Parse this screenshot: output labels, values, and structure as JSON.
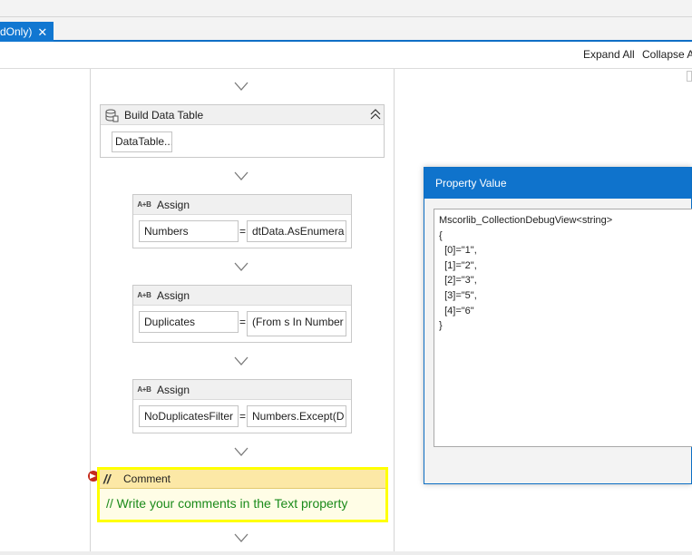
{
  "tab": {
    "label": "dOnly)",
    "close_glyph": "✕"
  },
  "toolbar": {
    "expand_all": "Expand All",
    "collapse_all": "Collapse A"
  },
  "activities": {
    "build_table": {
      "title": "Build Data Table",
      "button": "DataTable..."
    },
    "assign1": {
      "icon_text": "A+B",
      "title": "Assign",
      "to": "Numbers",
      "eq": "=",
      "value": "dtData.AsEnumera"
    },
    "assign2": {
      "icon_text": "A+B",
      "title": "Assign",
      "to": "Duplicates",
      "eq": "=",
      "value": "(From s In Number"
    },
    "assign3": {
      "icon_text": "A+B",
      "title": "Assign",
      "to": "NoDuplicatesFilter",
      "eq": "=",
      "value": "Numbers.Except(D"
    },
    "comment": {
      "icon_text": "//",
      "title": "Comment",
      "body": "// Write your comments in the Text property"
    }
  },
  "dialog": {
    "title": "Property Value",
    "lines": [
      "Mscorlib_CollectionDebugView<string>",
      "{",
      "  [0]=\"1\",",
      "  [1]=\"2\",",
      "  [2]=\"3\",",
      "  [3]=\"5\",",
      "  [4]=\"6\"",
      "}"
    ]
  },
  "colors": {
    "accent": "#0f73cc",
    "comment_border": "#ffff00",
    "comment_text": "#1a8a1a"
  }
}
